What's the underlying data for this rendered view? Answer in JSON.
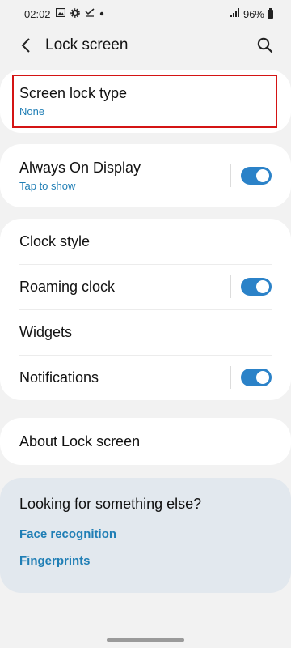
{
  "status_bar": {
    "time": "02:02",
    "signal_glyph": "▂▄▆",
    "battery_pct": "96%"
  },
  "app_bar": {
    "title": "Lock screen"
  },
  "lock_type": {
    "title": "Screen lock type",
    "value": "None"
  },
  "aod": {
    "title": "Always On Display",
    "subtitle": "Tap to show",
    "enabled": true
  },
  "settings": {
    "clock_style": "Clock style",
    "roaming_clock": "Roaming clock",
    "widgets": "Widgets",
    "notifications": "Notifications"
  },
  "about": {
    "title": "About Lock screen"
  },
  "suggestions": {
    "title": "Looking for something else?",
    "links": [
      "Face recognition",
      "Fingerprints"
    ]
  },
  "colors": {
    "accent": "#1f7eb5",
    "toggle_on": "#2b82c8",
    "highlight_border": "#d41414",
    "background": "#f2f2f2",
    "suggest_bg": "#e2e8ee"
  }
}
